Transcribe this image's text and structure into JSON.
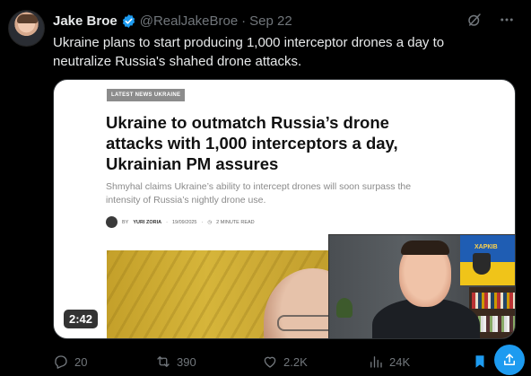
{
  "post": {
    "author_name": "Jake Broe",
    "handle": "@RealJakeBroe",
    "separator": "·",
    "date": "Sep 22",
    "text": "Ukraine plans to start producing 1,000 interceptor drones a day to neutralize Russia's shahed drone attacks."
  },
  "media": {
    "article": {
      "tag": "LATEST NEWS UKRAINE",
      "headline": "Ukraine to outmatch Russia’s drone attacks with 1,000 interceptors a day, Ukrainian PM assures",
      "subhead": "Shmyhal claims Ukraine’s ability to intercept drones will soon surpass the intensity of Russia’s nightly drone use.",
      "byline_prefix": "BY",
      "author": "YURI ZORIA",
      "byline_date": "19/09/2025",
      "read_time": "2 MINUTE READ"
    },
    "duration": "2:42",
    "pip_flag_text": "ХАРКІВ"
  },
  "actions": {
    "replies": "20",
    "reposts": "390",
    "likes": "2.2K",
    "views": "24K"
  },
  "colors": {
    "background": "#000000",
    "primary_text": "#e7e9ea",
    "secondary_text": "#71767b",
    "accent": "#1d9bf0"
  },
  "icons": [
    "verified-badge-icon",
    "grok-icon",
    "more-icon",
    "reply-icon",
    "repost-icon",
    "like-icon",
    "views-icon",
    "bookmark-icon",
    "share-icon"
  ]
}
